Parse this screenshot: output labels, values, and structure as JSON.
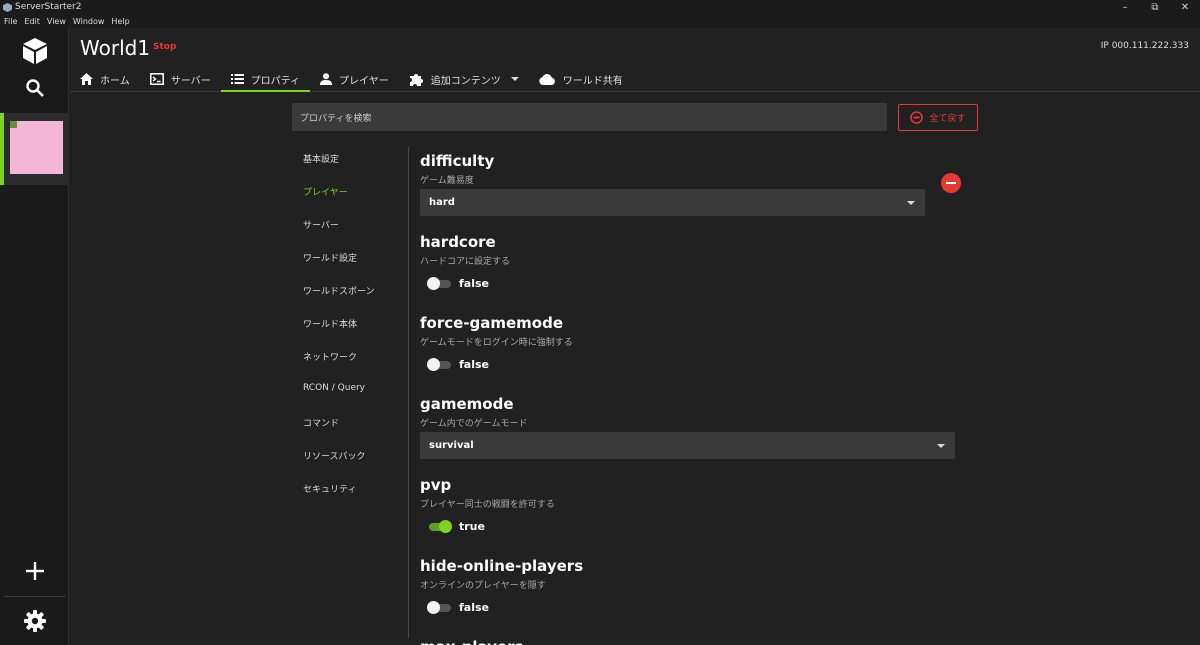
{
  "window": {
    "title": "ServerStarter2"
  },
  "menu": {
    "items": [
      "File",
      "Edit",
      "View",
      "Window",
      "Help"
    ]
  },
  "header": {
    "world_name": "World1",
    "status": "Stop",
    "ip": "IP 000.111.222.333"
  },
  "tabs": [
    {
      "label": "ホーム",
      "icon": "home-icon"
    },
    {
      "label": "サーバー",
      "icon": "terminal-icon"
    },
    {
      "label": "プロパティ",
      "icon": "list-icon"
    },
    {
      "label": "プレイヤー",
      "icon": "person-icon"
    },
    {
      "label": "追加コンテンツ",
      "icon": "puzzle-icon"
    },
    {
      "label": "ワールド共有",
      "icon": "cloud-icon"
    }
  ],
  "search": {
    "placeholder": "プロパティを検索"
  },
  "reset_all": {
    "label": "全て戻す"
  },
  "categories": [
    "基本設定",
    "プレイヤー",
    "サーバー",
    "ワールド設定",
    "ワールドスポーン",
    "ワールド本体",
    "ネットワーク",
    "RCON / Query",
    "コマンド",
    "リソースパック",
    "セキュリティ"
  ],
  "active_category": "プレイヤー",
  "properties": {
    "difficulty": {
      "name": "difficulty",
      "desc": "ゲーム難易度",
      "value": "hard"
    },
    "hardcore": {
      "name": "hardcore",
      "desc": "ハードコアに設定する",
      "value": "false"
    },
    "force_gamemode": {
      "name": "force-gamemode",
      "desc": "ゲームモードをログイン時に強制する",
      "value": "false"
    },
    "gamemode": {
      "name": "gamemode",
      "desc": "ゲーム内でのゲームモード",
      "value": "survival"
    },
    "pvp": {
      "name": "pvp",
      "desc": "プレイヤー同士の戦闘を許可する",
      "value": "true"
    },
    "hide_online_players": {
      "name": "hide-online-players",
      "desc": "オンラインのプレイヤーを隠す",
      "value": "false"
    },
    "max_players": {
      "name": "max-players"
    }
  },
  "colors": {
    "accent": "#7ed321",
    "danger": "#e53935",
    "background": "#212121"
  }
}
